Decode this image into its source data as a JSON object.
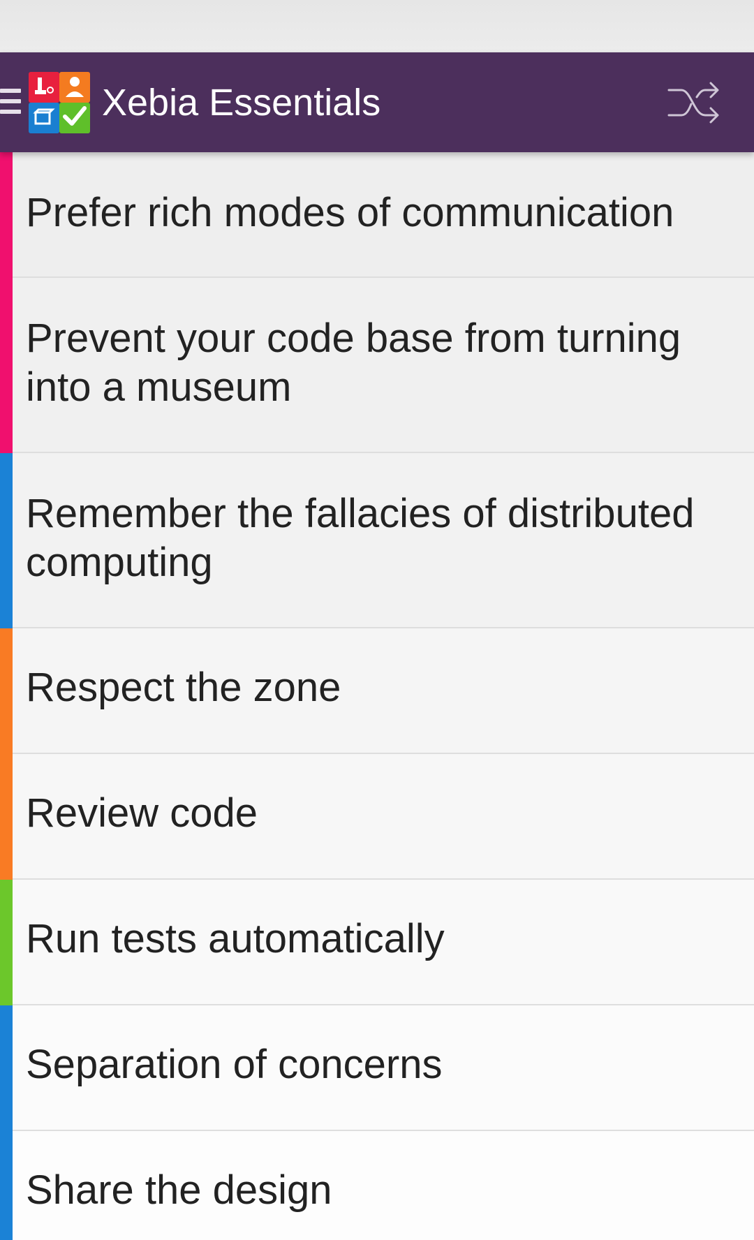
{
  "app_bar": {
    "title": "Xebia Essentials",
    "background": "#4c2f5c",
    "menu_icon": "hamburger-icon",
    "shuffle_icon": "shuffle-icon"
  },
  "logo": {
    "colors": [
      "#e8203e",
      "#f47b20",
      "#1a7fd1",
      "#5fbf2a"
    ]
  },
  "items": [
    {
      "label": "Prefer rich modes of communication",
      "color": "#f0106e"
    },
    {
      "label": "Prevent your code base from turning into a museum",
      "color": "#f0106e"
    },
    {
      "label": "Remember the fallacies of distributed computing",
      "color": "#1b82d6"
    },
    {
      "label": "Respect the zone",
      "color": "#f97b24"
    },
    {
      "label": "Review code",
      "color": "#f97b24"
    },
    {
      "label": "Run tests automatically",
      "color": "#6cc72b"
    },
    {
      "label": "Separation of concerns",
      "color": "#1b82d6"
    },
    {
      "label": "Share the design",
      "color": "#1b82d6"
    }
  ]
}
